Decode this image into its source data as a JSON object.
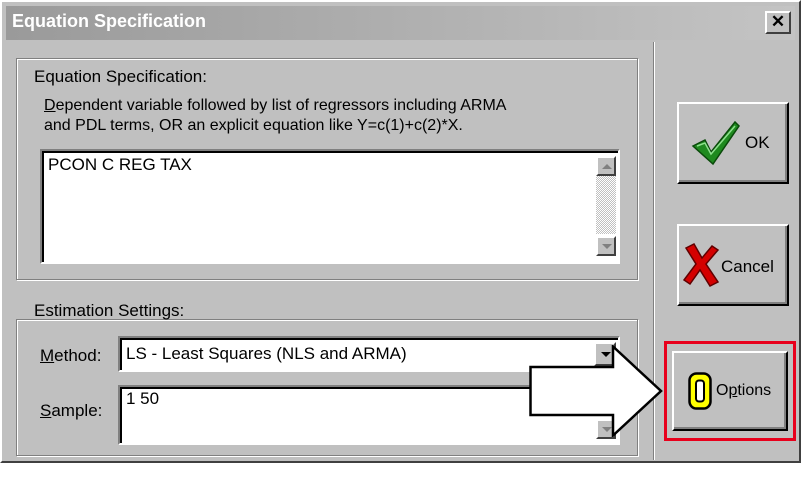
{
  "dialog": {
    "title": "Equation Specification"
  },
  "equation": {
    "group_label": "Equation Specification:",
    "instructions_line1": "Dependent variable followed by list of regressors including ARMA",
    "instructions_line2": "and PDL terms, OR an explicit equation like Y=c(1)+c(2)*X.",
    "value": "PCON C REG TAX"
  },
  "estimation": {
    "group_label": "Estimation Settings:",
    "method_label": "Method:",
    "method_value": "LS  -  Least Squares (NLS and ARMA)",
    "sample_label": "Sample:",
    "sample_value": "1 50"
  },
  "buttons": {
    "ok": "OK",
    "cancel": "Cancel",
    "options": "Options"
  },
  "icons": {
    "ok": "green-checkmark-icon",
    "cancel": "red-x-icon",
    "options": "yellow-o-icon",
    "close": "close-icon"
  },
  "colors": {
    "highlight_border": "#e8001c",
    "check_green": "#1f8a1f",
    "x_red": "#d40000",
    "o_yellow": "#ffff00"
  }
}
